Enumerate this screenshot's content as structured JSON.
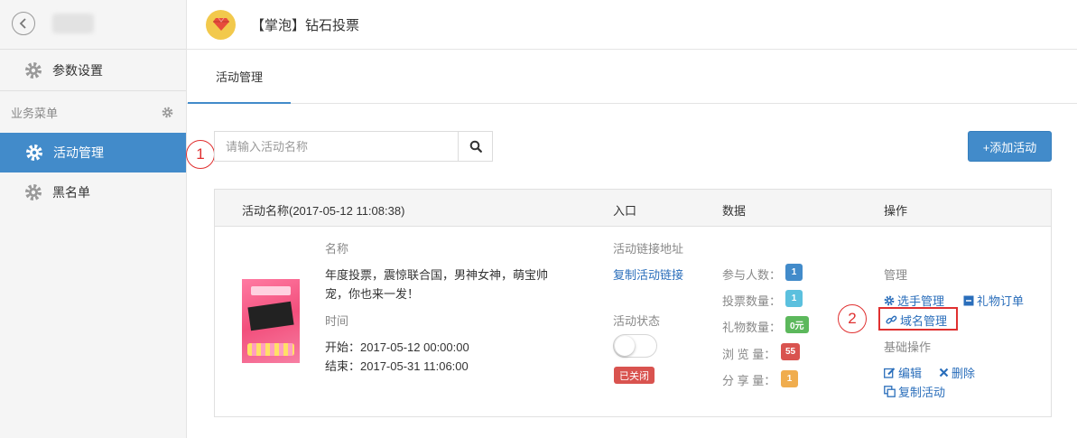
{
  "sidebar": {
    "items": [
      {
        "label": "参数设置",
        "icon": "gear-icon"
      }
    ],
    "section_label": "业务菜单",
    "menu": [
      {
        "label": "活动管理",
        "icon": "gear-icon",
        "active": true
      },
      {
        "label": "黑名单",
        "icon": "gear-icon",
        "active": false
      }
    ]
  },
  "header": {
    "title": "【掌泡】钻石投票",
    "logo_icon": "diamond-icon"
  },
  "tabs": [
    {
      "label": "活动管理",
      "active": true
    }
  ],
  "search": {
    "placeholder": "请输入活动名称",
    "value": "",
    "button_icon": "search-icon"
  },
  "add_button": {
    "label": "+添加活动"
  },
  "annotations": {
    "one": "1",
    "two": "2"
  },
  "table": {
    "columns": [
      "活动名称(2017-05-12 11:08:38)",
      "入口",
      "数据",
      "操作"
    ],
    "row": {
      "name_label": "名称",
      "name_value_line1": "年度投票，震惊联合国，男神女神，萌宝帅",
      "name_value_line2": "宠，你也来一发！",
      "time_label": "时间",
      "start": "开始：2017-05-12 00:00:00",
      "end": "结束：2017-05-31 11:06:00",
      "entry_label": "活动链接地址",
      "copy_link": "复制活动链接",
      "status_label": "活动状态",
      "status_badge": "已关闭",
      "stats": [
        {
          "label": "参与人数：",
          "value": "1",
          "color": "#428bca"
        },
        {
          "label": "投票数量：",
          "value": "1",
          "color": "#5bc0de"
        },
        {
          "label": "礼物数量：",
          "value": "0元",
          "color": "#5cb85c"
        },
        {
          "label": "浏 览 量：",
          "value": "55",
          "color": "#d9534f"
        },
        {
          "label": "分 享 量：",
          "value": "1",
          "color": "#f0ad4e"
        }
      ],
      "ops": {
        "manage_label": "管理",
        "player_manage": "选手管理",
        "gift_order": "礼物订单",
        "domain_manage": "域名管理",
        "basic_label": "基础操作",
        "edit": "编辑",
        "delete": "删除",
        "copy_activity": "复制活动"
      }
    }
  }
}
